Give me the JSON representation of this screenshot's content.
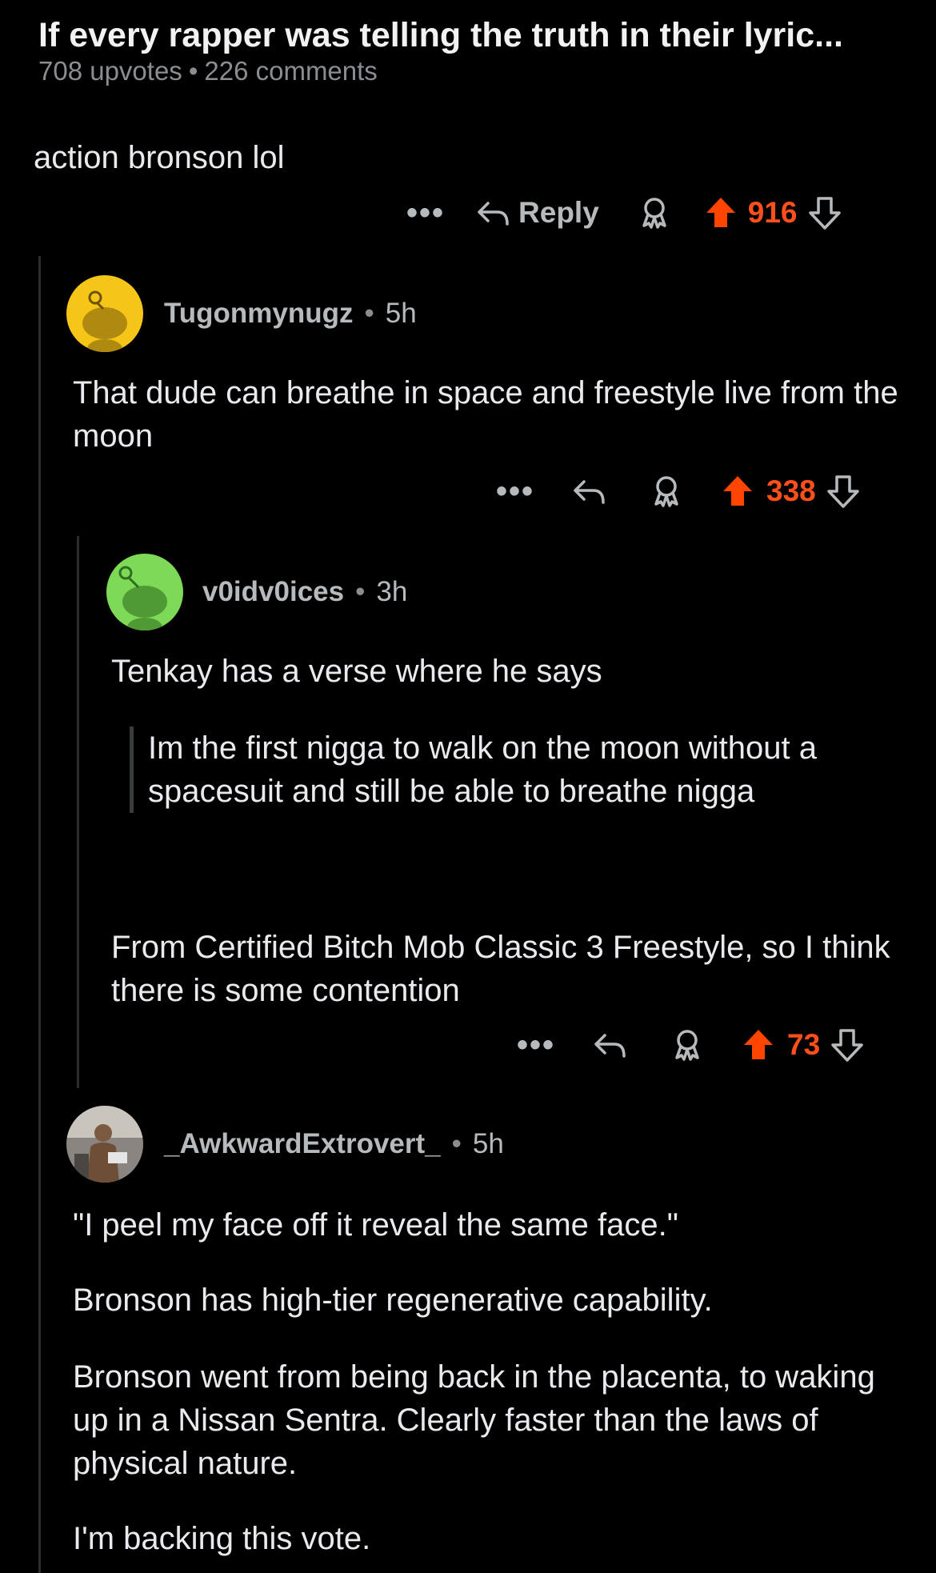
{
  "post": {
    "title": "If every rapper was telling the truth in their lyric...",
    "upvotes": "708 upvotes",
    "comments": "226 comments"
  },
  "comments": [
    {
      "body": "action bronson lol",
      "actions": {
        "dots": "•••",
        "reply": "Reply",
        "score": "916"
      }
    },
    {
      "author": "Tugonmynugz",
      "age": "5h",
      "avatar_color": "#f5c518",
      "body": "That dude can breathe in space and freestyle live from the moon",
      "actions": {
        "dots": "•••",
        "score": "338"
      }
    },
    {
      "author": "v0idv0ices",
      "age": "3h",
      "avatar_color": "#7ed957",
      "body_intro": "Tenkay has a verse where he says",
      "quote": "Im the first nigga to walk on the moon without a spacesuit and still be able to breathe nigga",
      "body_outro": "From Certified Bitch Mob Classic 3 Freestyle, so I think there is some contention",
      "actions": {
        "dots": "•••",
        "score": "73"
      }
    },
    {
      "author": "_AwkwardExtrovert_",
      "age": "5h",
      "para1": "\"I peel my face off it reveal the same face.\"",
      "para2": "Bronson has high-tier regenerative capability.",
      "para3": "Bronson went from being back in the placenta, to waking up in a Nissan Sentra. Clearly faster than the laws of physical nature.",
      "para4": "I'm backing this vote."
    }
  ],
  "colors": {
    "upvote_active": "#ff4500",
    "score": "#ff4f1a",
    "thread_line": "#2b2c2e"
  }
}
